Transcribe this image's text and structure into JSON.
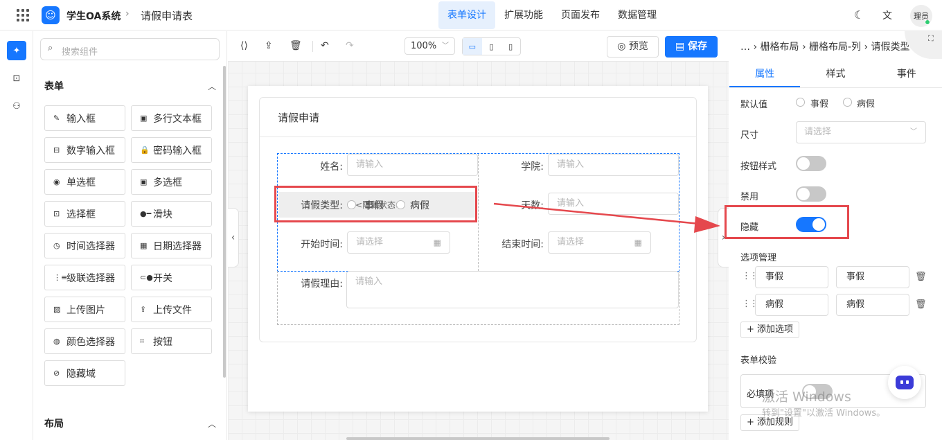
{
  "header": {
    "app_name": "学生OA系统",
    "separator": "›",
    "page_name": "请假申请表",
    "nav": [
      "表单设计",
      "扩展功能",
      "页面发布",
      "数据管理"
    ],
    "nav_active": "表单设计",
    "avatar_text": "理员"
  },
  "components": {
    "search_placeholder": "搜索组件",
    "form_section": "表单",
    "layout_section": "布局",
    "items": [
      {
        "label": "输入框",
        "icon": "pencil-icon",
        "glyph": "✎"
      },
      {
        "label": "多行文本框",
        "icon": "textarea-icon",
        "glyph": "▣"
      },
      {
        "label": "数字输入框",
        "icon": "number-input-icon",
        "glyph": "⊟"
      },
      {
        "label": "密码输入框",
        "icon": "lock-icon",
        "glyph": "🔒"
      },
      {
        "label": "单选框",
        "icon": "radio-icon",
        "glyph": "◉"
      },
      {
        "label": "多选框",
        "icon": "checkbox-icon",
        "glyph": "▣"
      },
      {
        "label": "选择框",
        "icon": "select-icon",
        "glyph": "⊡"
      },
      {
        "label": "滑块",
        "icon": "slider-icon",
        "glyph": "●━"
      },
      {
        "label": "时间选择器",
        "icon": "clock-icon",
        "glyph": "◷"
      },
      {
        "label": "日期选择器",
        "icon": "calendar-icon",
        "glyph": "▦"
      },
      {
        "label": "级联选择器",
        "icon": "cascader-icon",
        "glyph": "⋮≡"
      },
      {
        "label": "开关",
        "icon": "switch-icon",
        "glyph": "⊂●"
      },
      {
        "label": "上传图片",
        "icon": "image-icon",
        "glyph": "▨"
      },
      {
        "label": "上传文件",
        "icon": "upload-icon",
        "glyph": "⇪"
      },
      {
        "label": "颜色选择器",
        "icon": "palette-icon",
        "glyph": "◍"
      },
      {
        "label": "按钮",
        "icon": "button-icon",
        "glyph": "⌗"
      },
      {
        "label": "隐藏域",
        "icon": "eye-off-icon",
        "glyph": "⊘"
      }
    ]
  },
  "toolbar": {
    "zoom": "100%",
    "preview_label": "预览",
    "save_label": "保存"
  },
  "form": {
    "title": "请假申请",
    "fields": {
      "name_label": "姓名:",
      "name_placeholder": "请输入",
      "college_label": "学院:",
      "college_placeholder": "请输入",
      "type_label": "请假类型:",
      "type_hidden_tag": "<隐藏状态>",
      "type_option_1": "事假",
      "type_option_2": "病假",
      "days_label": "天数:",
      "days_placeholder": "请输入",
      "start_label": "开始时间:",
      "start_placeholder": "请选择",
      "end_label": "结束时间:",
      "end_placeholder": "请选择",
      "reason_label": "请假理由:",
      "reason_placeholder": "请输入"
    }
  },
  "props": {
    "breadcrumb": "… › 栅格布局 › 栅格布局-列 › 请假类型",
    "tabs": [
      "属性",
      "样式",
      "事件"
    ],
    "tab_active": "属性",
    "default_value_label": "默认值",
    "default_options": [
      "事假",
      "病假"
    ],
    "size_label": "尺寸",
    "size_placeholder": "请选择",
    "button_style_label": "按钮样式",
    "button_style_on": false,
    "disabled_label": "禁用",
    "disabled_on": false,
    "hidden_label": "隐藏",
    "hidden_on": true,
    "option_mgmt_label": "选项管理",
    "options": [
      {
        "label": "事假",
        "value": "事假"
      },
      {
        "label": "病假",
        "value": "病假"
      }
    ],
    "add_option_label": "+ 添加选项",
    "validation_label": "表单校验",
    "required_label": "必填项",
    "required_on": false,
    "add_rule_label": "+ 添加规则"
  },
  "watermark": {
    "line1": "激活 Windows",
    "line2": "转到\"设置\"以激活 Windows。"
  },
  "colors": {
    "accent": "#1677ff",
    "annotation_red": "#e5484d"
  }
}
